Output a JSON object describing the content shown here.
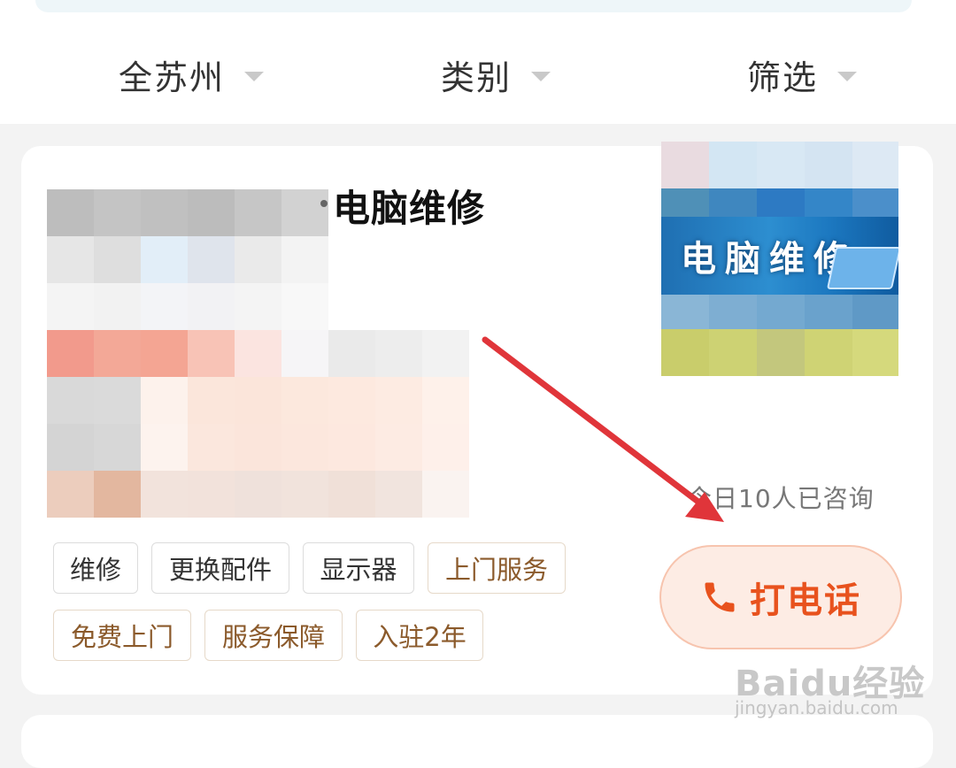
{
  "filters": [
    {
      "label": "全苏州"
    },
    {
      "label": "类别"
    },
    {
      "label": "筛选"
    }
  ],
  "listing": {
    "title": "电脑维修",
    "thumbnail_text": "电脑维修",
    "consult_text": "今日10人已咨询",
    "tags_row1": [
      "维修",
      "更换配件",
      "显示器",
      "上门服务"
    ],
    "tags_row2": [
      "免费上门",
      "服务保障",
      "入驻2年"
    ],
    "call_label": "打电话"
  },
  "watermark": {
    "logo_text": "Baidu经验",
    "url": "jingyan.baidu.com"
  },
  "icons": {
    "call": "phone-icon",
    "dropdown": "caret-down-icon"
  },
  "colors": {
    "accent": "#e8521d",
    "annotation_arrow": "#e0353a"
  }
}
